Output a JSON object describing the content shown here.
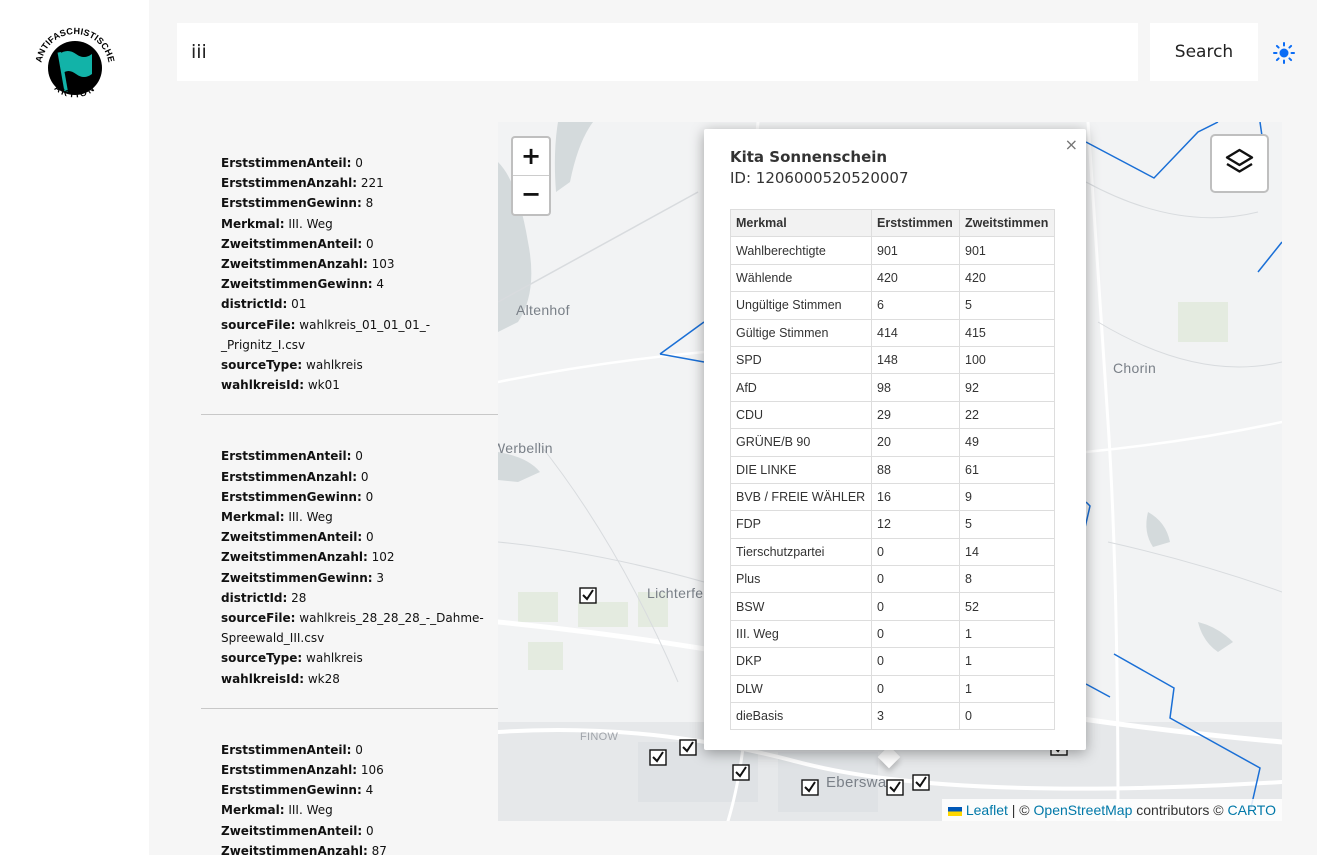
{
  "logo": {
    "text_top": "ANTIFASCHISTISCHE",
    "text_bottom": "AKTION",
    "color": "#12b3a8"
  },
  "search": {
    "value": "iii",
    "button_label": "Search"
  },
  "theme": {
    "accent": "#0a6cf5",
    "icon": "sun-icon"
  },
  "results": [
    {
      "rows": [
        {
          "key": "ErststimmenAnteil:",
          "value": "0"
        },
        {
          "key": "ErststimmenAnzahl:",
          "value": "221"
        },
        {
          "key": "ErststimmenGewinn:",
          "value": "8"
        },
        {
          "key": "Merkmal:",
          "value": "III. Weg"
        },
        {
          "key": "ZweitstimmenAnteil:",
          "value": "0"
        },
        {
          "key": "ZweitstimmenAnzahl:",
          "value": "103"
        },
        {
          "key": "ZweitstimmenGewinn:",
          "value": "4"
        },
        {
          "key": "districtId:",
          "value": "01"
        },
        {
          "key": "sourceFile:",
          "value": "wahlkreis_01_01_01_-_Prignitz_I.csv"
        },
        {
          "key": "sourceType:",
          "value": "wahlkreis"
        },
        {
          "key": "wahlkreisId:",
          "value": "wk01"
        }
      ]
    },
    {
      "rows": [
        {
          "key": "ErststimmenAnteil:",
          "value": "0"
        },
        {
          "key": "ErststimmenAnzahl:",
          "value": "0"
        },
        {
          "key": "ErststimmenGewinn:",
          "value": "0"
        },
        {
          "key": "Merkmal:",
          "value": "III. Weg"
        },
        {
          "key": "ZweitstimmenAnteil:",
          "value": "0"
        },
        {
          "key": "ZweitstimmenAnzahl:",
          "value": "102"
        },
        {
          "key": "ZweitstimmenGewinn:",
          "value": "3"
        },
        {
          "key": "districtId:",
          "value": "28"
        },
        {
          "key": "sourceFile:",
          "value": "wahlkreis_28_28_28_-_Dahme-Spreewald_III.csv"
        },
        {
          "key": "sourceType:",
          "value": "wahlkreis"
        },
        {
          "key": "wahlkreisId:",
          "value": "wk28"
        }
      ]
    },
    {
      "rows": [
        {
          "key": "ErststimmenAnteil:",
          "value": "0"
        },
        {
          "key": "ErststimmenAnzahl:",
          "value": "106"
        },
        {
          "key": "ErststimmenGewinn:",
          "value": "4"
        },
        {
          "key": "Merkmal:",
          "value": "III. Weg"
        },
        {
          "key": "ZweitstimmenAnteil:",
          "value": "0"
        },
        {
          "key": "ZweitstimmenAnzahl:",
          "value": "87"
        }
      ]
    }
  ],
  "map": {
    "labels": [
      "Altenhof",
      "Werbellin",
      "Chorin",
      "Lichterfel",
      "FINOW",
      "Eberswa"
    ],
    "zoom_in": "+",
    "zoom_out": "−",
    "boundary_color": "#1a6fd6",
    "popup": {
      "close": "×",
      "title": "Kita Sonnenschein",
      "id_line": "ID: 1206000520520007",
      "columns": [
        "Merkmal",
        "Erststimmen",
        "Zweitstimmen"
      ],
      "rows": [
        [
          "Wahlberechtigte",
          "901",
          "901"
        ],
        [
          "Wählende",
          "420",
          "420"
        ],
        [
          "Ungültige Stimmen",
          "6",
          "5"
        ],
        [
          "Gültige Stimmen",
          "414",
          "415"
        ],
        [
          "SPD",
          "148",
          "100"
        ],
        [
          "AfD",
          "98",
          "92"
        ],
        [
          "CDU",
          "29",
          "22"
        ],
        [
          "GRÜNE/B 90",
          "20",
          "49"
        ],
        [
          "DIE LINKE",
          "88",
          "61"
        ],
        [
          "BVB / FREIE WÄHLER",
          "16",
          "9"
        ],
        [
          "FDP",
          "12",
          "5"
        ],
        [
          "Tierschutzpartei",
          "0",
          "14"
        ],
        [
          "Plus",
          "0",
          "8"
        ],
        [
          "BSW",
          "0",
          "52"
        ],
        [
          "III. Weg",
          "0",
          "1"
        ],
        [
          "DKP",
          "0",
          "1"
        ],
        [
          "DLW",
          "0",
          "1"
        ],
        [
          "dieBasis",
          "3",
          "0"
        ]
      ]
    },
    "attribution": {
      "leaflet": "Leaflet",
      "sep": "| ©",
      "osm": "OpenStreetMap",
      "contributors": "contributors ©",
      "carto": "CARTO"
    }
  }
}
